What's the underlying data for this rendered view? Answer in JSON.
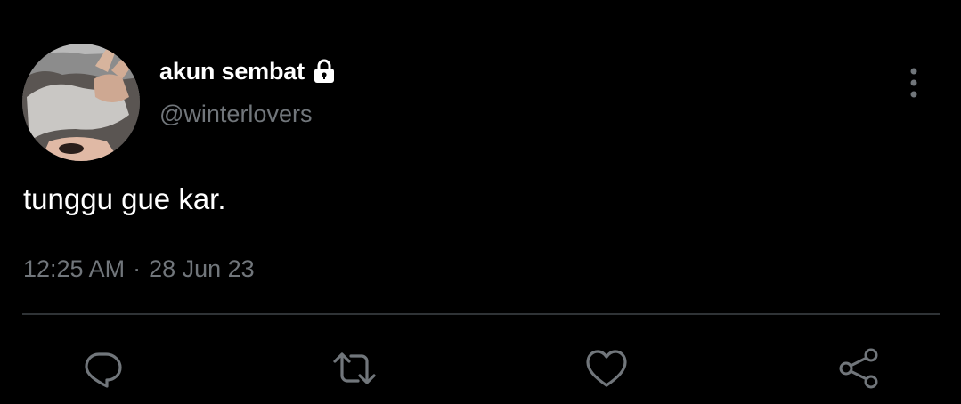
{
  "tweet": {
    "display_name": "akun sembat",
    "handle": "@winterlovers",
    "text": "tunggu gue kar.",
    "time": "12:25 AM",
    "separator": "·",
    "date": "28 Jun 23",
    "protected": true
  },
  "icons": {
    "lock": "lock-icon",
    "more": "more-vertical-icon",
    "reply": "reply-icon",
    "retweet": "retweet-icon",
    "like": "heart-icon",
    "share": "share-icon"
  },
  "colors": {
    "background": "#000000",
    "primary_text": "#ffffff",
    "secondary_text": "#71767b",
    "divider": "#2f3336"
  }
}
